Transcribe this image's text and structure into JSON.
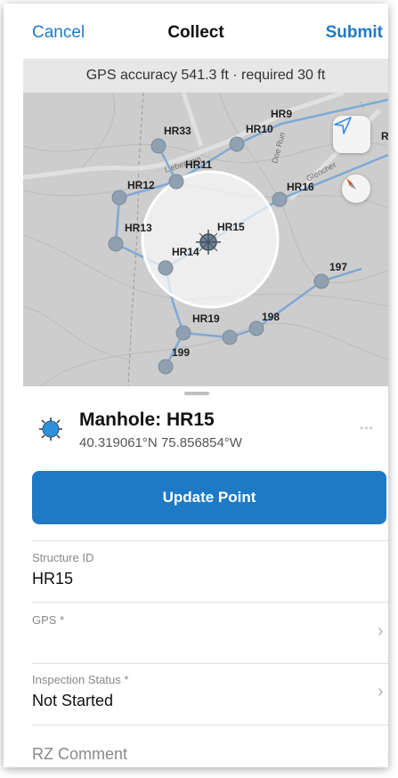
{
  "navbar": {
    "cancel_label": "Cancel",
    "title": "Collect",
    "submit_label": "Submit"
  },
  "gps_status": "GPS accuracy 541.3 ft · required 30 ft",
  "map": {
    "labels": [
      "HR9",
      "HR33",
      "HR10",
      "HR11",
      "HR12",
      "HR16",
      "HR13",
      "HR15",
      "HR14",
      "197",
      "HR19",
      "198",
      "199",
      "R"
    ],
    "street_labels": [
      "Lieberman",
      "Glencher",
      "Doe Run"
    ],
    "icons": [
      "locate-arrow-icon",
      "compass-icon",
      "manhole-icon"
    ]
  },
  "feature": {
    "title": "Manhole: HR15",
    "coords": "40.319061°N  75.856854°W",
    "more": "•••"
  },
  "update_button_label": "Update Point",
  "fields": [
    {
      "label": "Structure ID",
      "value": "HR15"
    },
    {
      "label": "GPS *",
      "value": ""
    },
    {
      "label": "Inspection Status *",
      "value": "Not Started"
    }
  ],
  "rz_comment_label": "RZ Comment",
  "colors": {
    "accent": "#1f7ac4",
    "gps_bar": "#e7e7e7",
    "map_bg": "#cdcdcd",
    "pipe": "#7fa8d6"
  }
}
